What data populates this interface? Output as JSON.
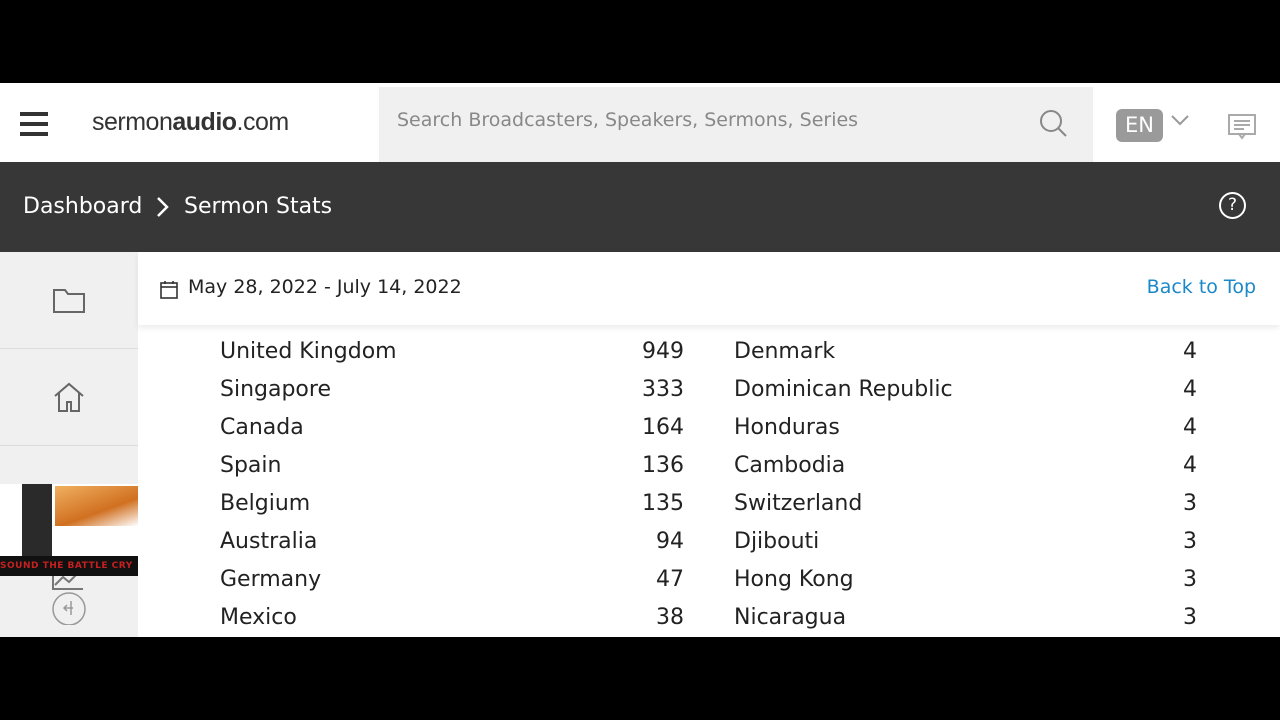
{
  "header": {
    "logo_light": "sermon",
    "logo_bold": "audio",
    "logo_tail": ".com",
    "search_placeholder": "Search Broadcasters, Speakers, Sermons, Series",
    "language": "EN"
  },
  "breadcrumb": {
    "items": [
      "Dashboard",
      "Sermon Stats"
    ]
  },
  "sidebar": {
    "banner_text": "SOUND THE BATTLE CRY"
  },
  "main": {
    "date_range": "May 28, 2022 - July 14, 2022",
    "back_to_top": "Back to Top",
    "left_countries": [
      [
        "United Kingdom",
        "949"
      ],
      [
        "Singapore",
        "333"
      ],
      [
        "Canada",
        "164"
      ],
      [
        "Spain",
        "136"
      ],
      [
        "Belgium",
        "135"
      ],
      [
        "Australia",
        "94"
      ],
      [
        "Germany",
        "47"
      ],
      [
        "Mexico",
        "38"
      ]
    ],
    "right_countries": [
      [
        "Denmark",
        "4"
      ],
      [
        "Dominican Republic",
        "4"
      ],
      [
        "Honduras",
        "4"
      ],
      [
        "Cambodia",
        "4"
      ],
      [
        "Switzerland",
        "3"
      ],
      [
        "Djibouti",
        "3"
      ],
      [
        "Hong Kong",
        "3"
      ],
      [
        "Nicaragua",
        "3"
      ]
    ]
  }
}
